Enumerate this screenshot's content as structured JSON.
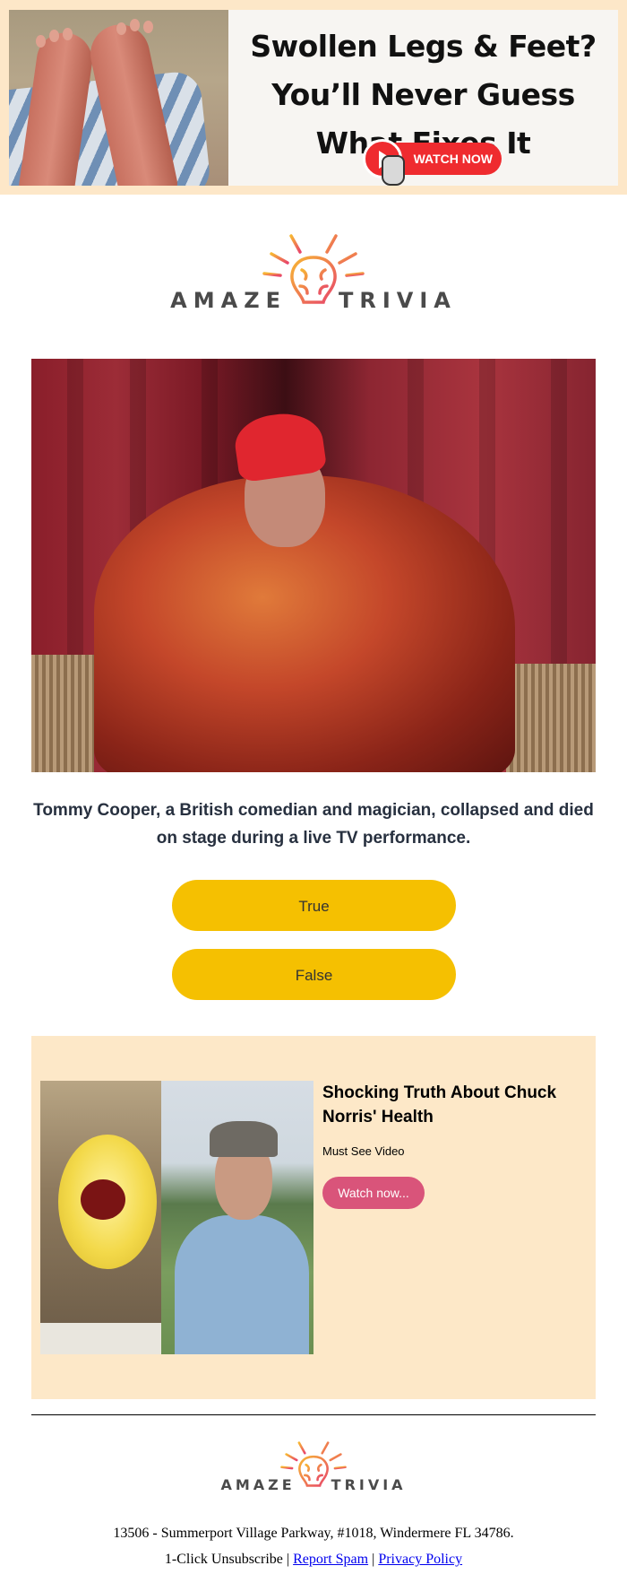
{
  "top_banner": {
    "headline": "Swollen Legs & Feet? You’ll Never Guess What Fixes It",
    "button_label": "WATCH NOW"
  },
  "logo": {
    "word_left": "AMAZE",
    "word_right": "TRIVIA"
  },
  "question": {
    "text": "Tommy Cooper, a British comedian and magician, collapsed and died on stage during a live TV performance.",
    "answers": [
      "True",
      "False"
    ]
  },
  "sponsored": {
    "title": "Shocking Truth About Chuck Norris' Health",
    "subtitle": "Must See Video",
    "button_label": "Watch now..."
  },
  "footer": {
    "address": "13506 - Summerport Village Parkway, #1018, Windermere FL 34786.",
    "unsubscribe_label": "1-Click Unsubscribe",
    "separator": "|",
    "report_spam_label": "Report Spam",
    "privacy_policy_label": "Privacy Policy"
  },
  "colors": {
    "banner_bg": "#fde7c8",
    "answer_button": "#f5c001",
    "card_bg": "#fde8c8",
    "card_button": "#d9547a",
    "watch_now": "#ef2b2f",
    "logo_orange": "#f28a2e",
    "logo_magenta": "#e8456b"
  }
}
